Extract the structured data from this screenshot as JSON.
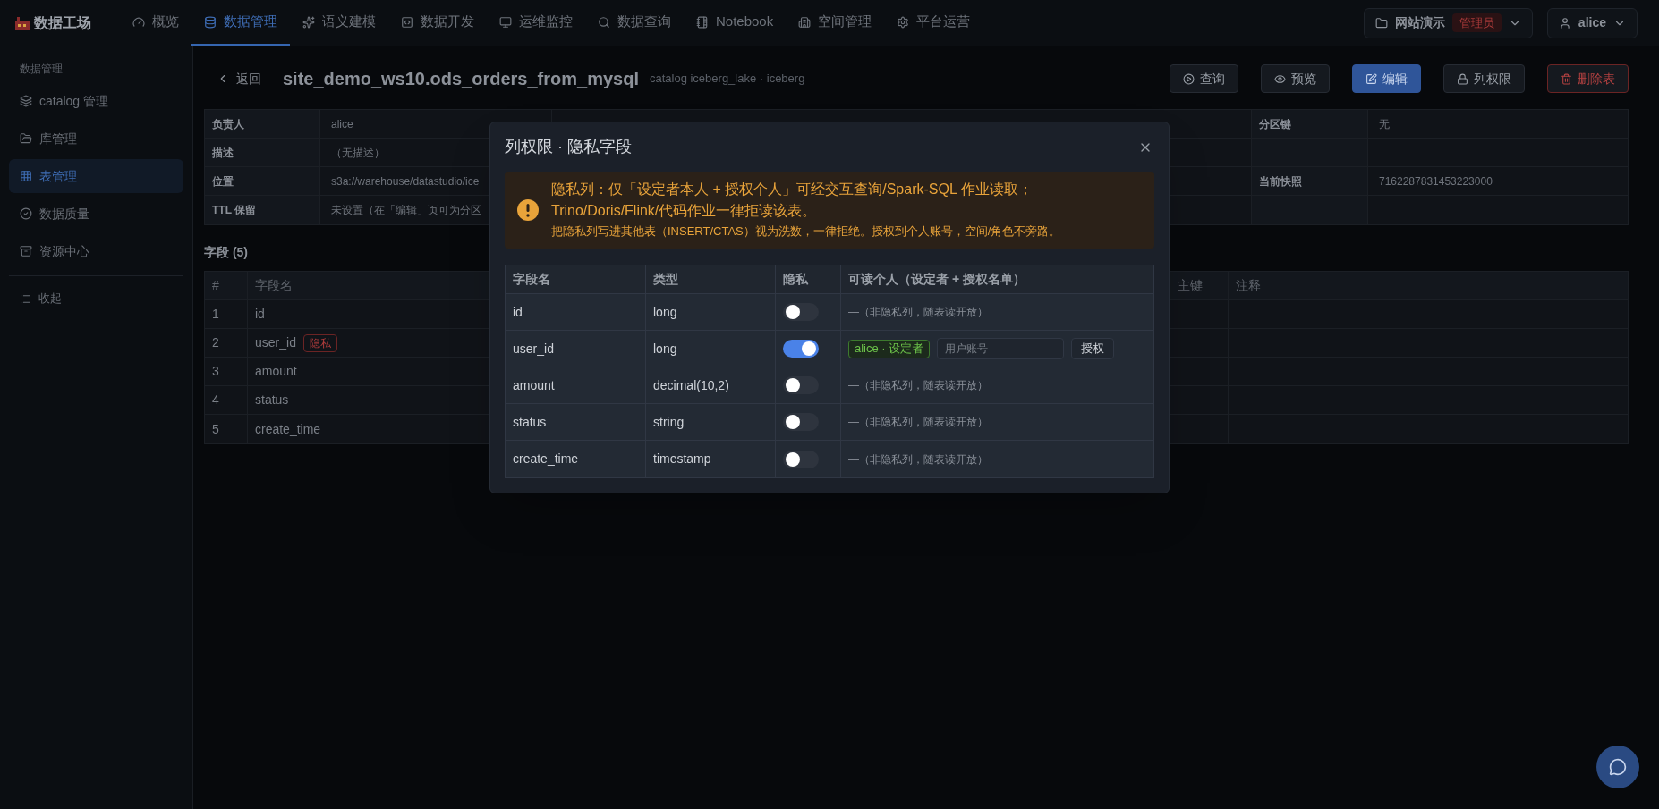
{
  "brand": {
    "name": "数据工场"
  },
  "nav": [
    {
      "label": "概览",
      "selected": false
    },
    {
      "label": "数据管理",
      "selected": true
    },
    {
      "label": "语义建模",
      "selected": false
    },
    {
      "label": "数据开发",
      "selected": false
    },
    {
      "label": "运维监控",
      "selected": false
    },
    {
      "label": "数据查询",
      "selected": false
    },
    {
      "label": "Notebook",
      "selected": false
    },
    {
      "label": "空间管理",
      "selected": false
    },
    {
      "label": "平台运营",
      "selected": false
    }
  ],
  "workspace": {
    "name": "网站演示",
    "role": "管理员"
  },
  "user": {
    "name": "alice"
  },
  "sidebar": {
    "section": "数据管理",
    "items": [
      {
        "label": "catalog 管理",
        "selected": false
      },
      {
        "label": "库管理",
        "selected": false
      },
      {
        "label": "表管理",
        "selected": true
      },
      {
        "label": "数据质量",
        "selected": false
      },
      {
        "label": "资源中心",
        "selected": false
      }
    ],
    "collapse": "收起"
  },
  "header": {
    "back": "返回",
    "title": "site_demo_ws10.ods_orders_from_mysql",
    "subtitle": "catalog iceberg_lake · iceberg",
    "buttons": [
      {
        "label": "查询",
        "kind": "default"
      },
      {
        "label": "预览",
        "kind": "default"
      },
      {
        "label": "编辑",
        "kind": "primary"
      },
      {
        "label": "列权限",
        "kind": "default"
      },
      {
        "label": "删除表",
        "kind": "danger"
      }
    ]
  },
  "info": [
    {
      "label": "负责人",
      "value": "alice",
      "label_3": "分区键",
      "value_3": "无"
    },
    {
      "label": "描述",
      "value": "（无描述）"
    },
    {
      "label": "位置",
      "value": "s3a://warehouse/datastudio/ice",
      "label_3": "当前快照",
      "value_3": "7162287831453223000"
    },
    {
      "label": "TTL 保留",
      "value": "未设置（在「编辑」页可为分区"
    }
  ],
  "fields": {
    "title": "字段 (5)",
    "columns": [
      "#",
      "字段名",
      "主键",
      "注释"
    ],
    "rows": [
      {
        "index": "1",
        "name": "id"
      },
      {
        "index": "2",
        "name": "user_id",
        "badge": "隐私"
      },
      {
        "index": "3",
        "name": "amount"
      },
      {
        "index": "4",
        "name": "status"
      },
      {
        "index": "5",
        "name": "create_time"
      }
    ]
  },
  "modal": {
    "title": "列权限 · 隐私字段",
    "alert": {
      "lines": [
        "隐私列：仅「设定者本人 + 授权个人」可经交互查询/Spark-SQL 作业读取；",
        "Trino/Doris/Flink/代码作业一律拒读该表。"
      ],
      "note": "把隐私列写进其他表（INSERT/CTAS）视为洗数，一律拒绝。授权到个人账号，空间/角色不旁路。"
    },
    "columns": [
      "字段名",
      "类型",
      "隐私",
      "可读个人（设定者 + 授权名单）"
    ],
    "rows": [
      {
        "name": "id",
        "type": "long",
        "private": false,
        "note": "—（非隐私列，随表读开放）"
      },
      {
        "name": "user_id",
        "type": "long",
        "private": true,
        "tag": "alice · 设定者",
        "placeholder": "用户账号",
        "button": "授权"
      },
      {
        "name": "amount",
        "type": "decimal(10,2)",
        "private": false,
        "note": "—（非隐私列，随表读开放）"
      },
      {
        "name": "status",
        "type": "string",
        "private": false,
        "note": "—（非隐私列，随表读开放）"
      },
      {
        "name": "create_time",
        "type": "timestamp",
        "private": false,
        "note": "—（非隐私列，随表读开放）"
      }
    ]
  }
}
